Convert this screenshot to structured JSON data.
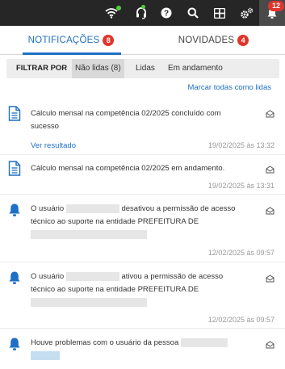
{
  "topbar": {
    "icons": [
      "wifi-icon",
      "headset-icon",
      "help-icon",
      "search-icon",
      "apps-grid-icon",
      "settings-icon",
      "bell-icon"
    ],
    "notification_count": "12"
  },
  "tabs": [
    {
      "label": "NOTIFICAÇÕES",
      "count": "8",
      "active": true
    },
    {
      "label": "NOVIDADES",
      "count": "4",
      "active": false
    }
  ],
  "filter": {
    "label": "FILTRAR POR",
    "options": [
      "Não lidas (8)",
      "Lidas",
      "Em andamento"
    ],
    "selected": "Não lidas (8)"
  },
  "mark_all": "Marcar todas como lidas",
  "notifications": [
    {
      "icon": "document-icon",
      "line1": "Cálculo mensal na competência 02/2025 concluído com",
      "line2": "sucesso",
      "link": "Ver resultado",
      "date": "19/02/2025 às 13:32"
    },
    {
      "icon": "document-icon",
      "line1": "Cálculo mensal na competência 02/2025 em andamento.",
      "date": "19/02/2025 às 13:31"
    },
    {
      "icon": "bell-icon",
      "line1_a": "O usuário",
      "line1_b": "desativou a permissão de acesso",
      "line2": "técnico ao suporte na entidade PREFEITURA DE",
      "date": "12/02/2025 às 09:57"
    },
    {
      "icon": "bell-icon",
      "line1_a": "O usuário",
      "line1_b": "ativou a permissão de acesso",
      "line2": "técnico ao suporte na entidade PREFEITURA DE",
      "date": "12/02/2025 às 09:57"
    },
    {
      "icon": "bell-icon",
      "line1": "Houve problemas com o usuário da pessoa"
    }
  ],
  "colors": {
    "topbar": "#262626",
    "accent": "#1f6fc5",
    "badge": "#e0352b",
    "filter_bg": "#ededed"
  }
}
